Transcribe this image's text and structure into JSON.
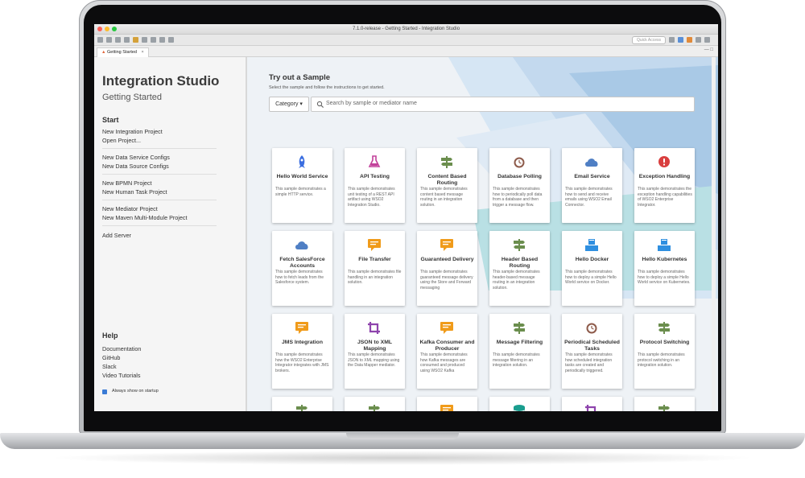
{
  "window": {
    "title": "7.1.0-release - Getting Started - Integration Studio"
  },
  "toolbar": {
    "quick_access": "Quick Access"
  },
  "editor_tab": {
    "label": "Getting Started"
  },
  "left_panel": {
    "title": "Integration Studio",
    "subtitle": "Getting Started",
    "start_heading": "Start",
    "start_groups": [
      [
        "New Integration Project",
        "Open Project..."
      ],
      [
        "New Data Service Configs",
        "New Data Source Configs"
      ],
      [
        "New BPMN Project",
        "New Human Task Project"
      ],
      [
        "New Mediator Project",
        "New Maven Multi-Module Project"
      ],
      [
        "Add Server"
      ]
    ],
    "help_heading": "Help",
    "help_links": [
      "Documentation",
      "GitHub",
      "Slack",
      "Video Tutorials"
    ],
    "startup_checkbox": "Always show on startup"
  },
  "samples": {
    "title": "Try out a Sample",
    "description": "Select the sample and follow the instructions to get started.",
    "category_button": "Category",
    "search_placeholder": "Search by sample or mediator name",
    "cards": [
      {
        "icon": "rocket-icon",
        "color": "#3b6ee0",
        "title": "Hello World Service",
        "desc": "This sample demonstrates a simple HTTP service."
      },
      {
        "icon": "flask-icon",
        "color": "#c2409a",
        "title": "API Testing",
        "desc": "This sample demonstrates unit testing of a REST API artifact using WSO2 Integration Studio."
      },
      {
        "icon": "signpost-icon",
        "color": "#6b8e4e",
        "title": "Content Based Routing",
        "desc": "This sample demonstrates content based message routing in an integration solution."
      },
      {
        "icon": "alarm-icon",
        "color": "#8d5a4a",
        "title": "Database Polling",
        "desc": "This sample demonstrates how to periodically poll data from a database and then trigger a message flow."
      },
      {
        "icon": "cloud-icon",
        "color": "#4f7fc4",
        "title": "Email Service",
        "desc": "This sample demonstrates how to send and receive emails using WSO2 Email Connector."
      },
      {
        "icon": "bug-icon",
        "color": "#d93f3f",
        "title": "Exception Handling",
        "desc": "This sample demonstrates the exception handling capabilities of WSO2 Enterprise Integrator."
      },
      {
        "icon": "cloud-icon",
        "color": "#4f7fc4",
        "title": "Fetch SalesForce Accounts",
        "desc": "This sample demonstrates how to fetch leads from the Salesforce system."
      },
      {
        "icon": "message-icon",
        "color": "#f09b1a",
        "title": "File Transfer",
        "desc": "This sample demonstrates file handling in an integration solution."
      },
      {
        "icon": "message-icon",
        "color": "#f09b1a",
        "title": "Guaranteed Delivery",
        "desc": "This sample demonstrates guaranteed message delivery using the Store and Forward messaging"
      },
      {
        "icon": "signpost-icon",
        "color": "#6b8e4e",
        "title": "Header Based Routing",
        "desc": "This sample demonstrates header-based message routing in an integration solution."
      },
      {
        "icon": "cubes-icon",
        "color": "#2f8fe0",
        "title": "Hello Docker",
        "desc": "This sample demonstrates how to deploy a simple Hello World service on Docker."
      },
      {
        "icon": "cubes-icon",
        "color": "#2f8fe0",
        "title": "Hello Kubernetes",
        "desc": "This sample demonstrates how to deploy a simple Hello World service on Kubernetes."
      },
      {
        "icon": "message-icon",
        "color": "#f09b1a",
        "title": "JMS Integration",
        "desc": "This sample demonstrates how the WSO2 Enterprise Integrator integrates with JMS brokers."
      },
      {
        "icon": "crop-icon",
        "color": "#8e44ad",
        "title": "JSON to XML Mapping",
        "desc": "This sample demonstrates JSON to XML mapping using the Data Mapper mediator."
      },
      {
        "icon": "message-icon",
        "color": "#f09b1a",
        "title": "Kafka Consumer and Producer",
        "desc": "This sample demonstrates how Kafka messages are consumed and produced using WSO2 Kafka"
      },
      {
        "icon": "signpost-icon",
        "color": "#6b8e4e",
        "title": "Message Filtering",
        "desc": "This sample demonstrates message filtering in an integration solution."
      },
      {
        "icon": "alarm-icon",
        "color": "#8d5a4a",
        "title": "Periodical Scheduled Tasks",
        "desc": "This sample demonstrates how scheduled integration tasks are created and periodically triggered."
      },
      {
        "icon": "signpost-icon",
        "color": "#6b8e4e",
        "title": "Protocol Switching",
        "desc": "This sample demonstrates protocol switching in an integration solution."
      },
      {
        "icon": "signpost-icon",
        "color": "#6b8e4e",
        "title": "",
        "desc": ""
      },
      {
        "icon": "signpost-icon",
        "color": "#6b8e4e",
        "title": "",
        "desc": ""
      },
      {
        "icon": "message-icon",
        "color": "#f09b1a",
        "title": "",
        "desc": ""
      },
      {
        "icon": "database-icon",
        "color": "#1a9e8f",
        "title": "",
        "desc": ""
      },
      {
        "icon": "crop-icon",
        "color": "#8e44ad",
        "title": "",
        "desc": ""
      },
      {
        "icon": "signpost-icon",
        "color": "#6b8e4e",
        "title": "",
        "desc": ""
      }
    ]
  }
}
